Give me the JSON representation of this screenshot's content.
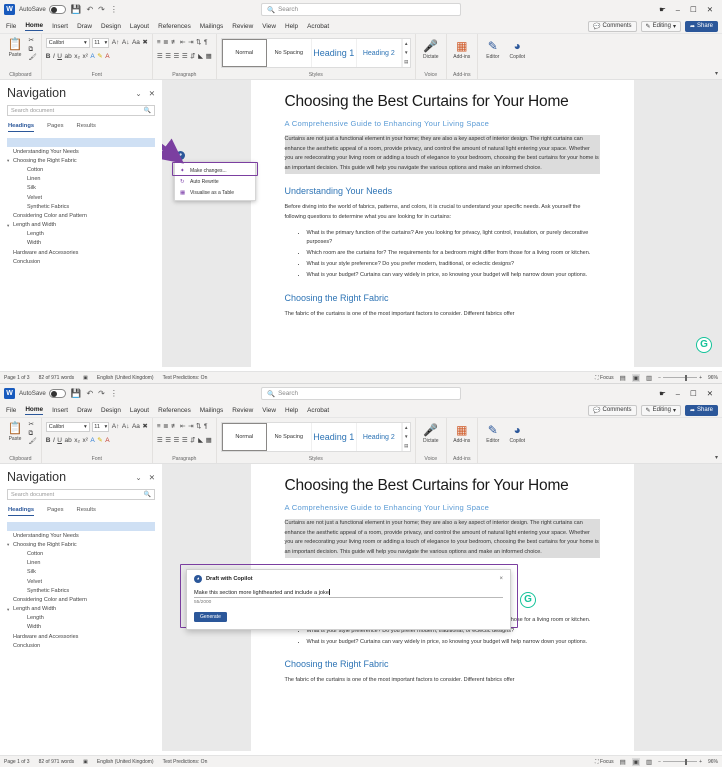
{
  "app": {
    "logo_letter": "W",
    "autosave_label": "AutoSave",
    "search_placeholder": "Search",
    "quick_access": [
      "save-icon",
      "undo-icon",
      "redo-icon",
      "more-icon"
    ],
    "window_controls": [
      "help-icon",
      "minimize",
      "restore",
      "close"
    ]
  },
  "tabs": [
    {
      "label": "File",
      "active": false
    },
    {
      "label": "Home",
      "active": true
    },
    {
      "label": "Insert",
      "active": false
    },
    {
      "label": "Draw",
      "active": false
    },
    {
      "label": "Design",
      "active": false
    },
    {
      "label": "Layout",
      "active": false
    },
    {
      "label": "References",
      "active": false
    },
    {
      "label": "Mailings",
      "active": false
    },
    {
      "label": "Review",
      "active": false
    },
    {
      "label": "View",
      "active": false
    },
    {
      "label": "Help",
      "active": false
    },
    {
      "label": "Acrobat",
      "active": false
    }
  ],
  "tab_right": {
    "comments": "Comments",
    "editing": "Editing",
    "share": "Share"
  },
  "ribbon": {
    "groups": {
      "clipboard": {
        "label": "Clipboard",
        "paste": "Paste"
      },
      "font": {
        "label": "Font",
        "font_name": "Calibri",
        "font_size": "11",
        "buttons": [
          "B",
          "I",
          "U"
        ]
      },
      "paragraph": {
        "label": "Paragraph"
      },
      "styles": {
        "label": "Styles",
        "items": [
          {
            "name": "Normal",
            "selected": true
          },
          {
            "name": "No Spacing",
            "selected": false
          },
          {
            "name": "Heading 1",
            "selected": false
          },
          {
            "name": "Heading 2",
            "selected": false
          }
        ]
      },
      "voice": {
        "label": "Voice",
        "dictate": "Dictate"
      },
      "addins": {
        "label": "Add-ins",
        "addins": "Add-ins"
      },
      "editor_group": {
        "editor": "Editor",
        "copilot": "Copilot"
      }
    }
  },
  "navigation": {
    "title": "Navigation",
    "search_placeholder": "Search document",
    "tabs": [
      {
        "label": "Headings",
        "active": true
      },
      {
        "label": "Pages",
        "active": false
      },
      {
        "label": "Results",
        "active": false
      }
    ],
    "items": [
      {
        "label": "",
        "level": 1,
        "selected": true,
        "expandable": false
      },
      {
        "label": "Understanding Your Needs",
        "level": 1,
        "selected": false,
        "expandable": false
      },
      {
        "label": "Choosing the Right Fabric",
        "level": 1,
        "selected": false,
        "expandable": true
      },
      {
        "label": "Cotton",
        "level": 2,
        "selected": false,
        "expandable": false
      },
      {
        "label": "Linen",
        "level": 2,
        "selected": false,
        "expandable": false
      },
      {
        "label": "Silk",
        "level": 2,
        "selected": false,
        "expandable": false
      },
      {
        "label": "Velvet",
        "level": 2,
        "selected": false,
        "expandable": false
      },
      {
        "label": "Synthetic Fabrics",
        "level": 2,
        "selected": false,
        "expandable": false
      },
      {
        "label": "Considering Color and Pattern",
        "level": 1,
        "selected": false,
        "expandable": false
      },
      {
        "label": "Length and Width",
        "level": 1,
        "selected": false,
        "expandable": true
      },
      {
        "label": "Length",
        "level": 2,
        "selected": false,
        "expandable": false
      },
      {
        "label": "Width",
        "level": 2,
        "selected": false,
        "expandable": false
      },
      {
        "label": "Hardware and Accessories",
        "level": 1,
        "selected": false,
        "expandable": false
      },
      {
        "label": "Conclusion",
        "level": 1,
        "selected": false,
        "expandable": false
      }
    ]
  },
  "document": {
    "title": "Choosing the Best Curtains for Your Home",
    "subtitle": "A Comprehensive Guide to Enhancing Your Living Space",
    "intro_paragraph": "Curtains are not just a functional element in your home; they are also a key aspect of interior design. The right curtains can enhance the aesthetic appeal of a room, provide privacy, and control the amount of natural light entering your space. Whether you are redecorating your living room or adding a touch of elegance to your bedroom, choosing the best curtains for your home is an important decision. This guide will help you navigate the various options and make an informed choice.",
    "section_needs": {
      "heading": "Understanding Your Needs",
      "paragraph": "Before diving into the world of fabrics, patterns, and colors, it is crucial to understand your specific needs. Ask yourself the following questions to determine what you are looking for in curtains:",
      "bullets": [
        "What is the primary function of the curtains? Are you looking for privacy, light control, insulation, or purely decorative purposes?",
        "Which room are the curtains for? The requirements for a bedroom might differ from those for a living room or kitchen.",
        "What is your style preference? Do you prefer modern, traditional, or eclectic designs?",
        "What is your budget? Curtains can vary widely in price, so knowing your budget will help narrow down your options."
      ]
    },
    "section_fabric": {
      "heading": "Choosing the Right Fabric",
      "paragraph": "The fabric of the curtains is one of the most important factors to consider. Different fabrics offer"
    }
  },
  "copilot_menu": {
    "icon_name": "copilot-icon",
    "items": [
      {
        "label": "Make changes...",
        "icon": "wand-icon",
        "highlighted": true
      },
      {
        "label": "Auto Rewrite",
        "icon": "rewrite-icon",
        "highlighted": false
      },
      {
        "label": "Visualise as a Table",
        "icon": "table-icon",
        "highlighted": false
      }
    ]
  },
  "copilot_dialog": {
    "title": "Draft with Copilot",
    "input_value": "Make this section more lighthearted and include a joke",
    "char_count": "55/2000",
    "generate_label": "Generate",
    "close_label": "×"
  },
  "status_bar": {
    "page": "Page 1 of 3",
    "words": "82 of 971 words",
    "language": "English (United Kingdom)",
    "predictions": "Text Predictions: On",
    "focus": "Focus",
    "zoom": "96%",
    "proofing_icon": "proofing-icon",
    "view_icons": [
      "read-mode-icon",
      "print-layout-icon",
      "web-layout-icon"
    ]
  },
  "annotations": {
    "arrow_color": "#7b3fa0",
    "highlight_color": "#7b3fa0",
    "grammarly_letter": "G",
    "grammarly_color": "#15c39a"
  }
}
